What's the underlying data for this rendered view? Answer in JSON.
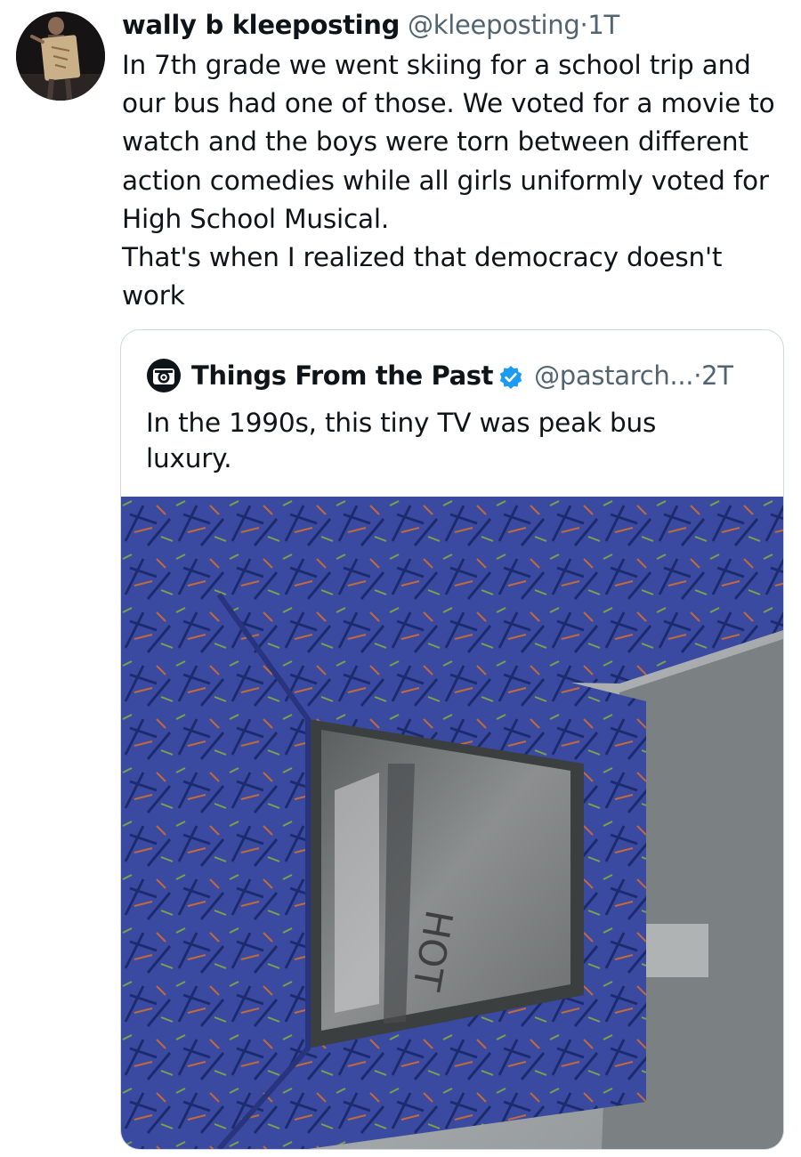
{
  "tweet": {
    "author_name": "wally b kleeposting",
    "author_handle": "@kleeposting",
    "separator": "·",
    "timestamp": "1T",
    "text_lines": [
      "In 7th grade we went skiing for a school trip and our bus had one of those. We voted for a movie to watch and the boys were torn between different action comedies while all girls uniformly voted for High School Musical.",
      "That's when I realized that democracy doesn't work"
    ]
  },
  "quote": {
    "author_name": "Things From the Past",
    "author_handle": "@pastarch...",
    "separator": "·",
    "timestamp": "2T",
    "verified_icon": "verified-badge-icon",
    "text": "In the 1990s, this tiny TV was peak bus luxury.",
    "photo_text": "HOT"
  },
  "colors": {
    "text_primary": "#0f1419",
    "text_secondary": "#536471",
    "verified_blue": "#1d9bf0",
    "card_border": "#cfd9de",
    "seat_fabric": "#3a4aa0"
  }
}
